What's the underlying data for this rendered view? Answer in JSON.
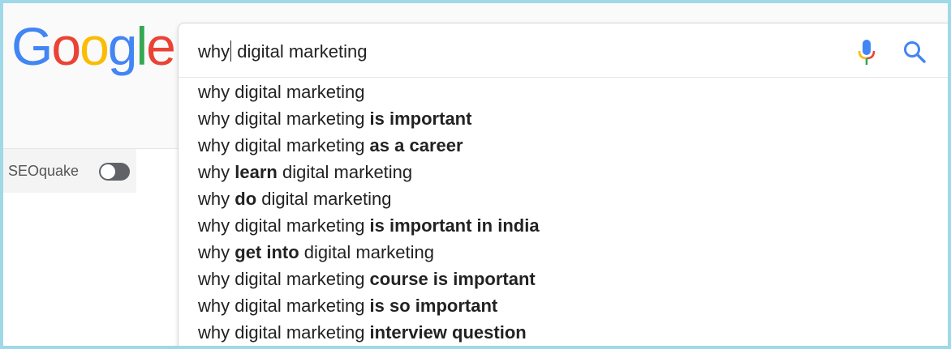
{
  "logo": {
    "text": "Google",
    "letters": [
      {
        "ch": "G",
        "color": "#4285F4"
      },
      {
        "ch": "o",
        "color": "#EA4335"
      },
      {
        "ch": "o",
        "color": "#FBBC05"
      },
      {
        "ch": "g",
        "color": "#4285F4"
      },
      {
        "ch": "l",
        "color": "#34A853"
      },
      {
        "ch": "e",
        "color": "#EA4335"
      }
    ]
  },
  "search": {
    "typed_before_caret": "why",
    "typed_after_caret": " digital marketing",
    "mic_icon": "microphone-icon",
    "search_icon": "magnifier-icon"
  },
  "seoquake": {
    "label": "SEOquake",
    "toggle_state": "off"
  },
  "suggestions": [
    [
      {
        "t": "why digital marketing",
        "b": false
      }
    ],
    [
      {
        "t": "why digital marketing ",
        "b": false
      },
      {
        "t": "is important",
        "b": true
      }
    ],
    [
      {
        "t": "why digital marketing ",
        "b": false
      },
      {
        "t": "as a career",
        "b": true
      }
    ],
    [
      {
        "t": "why ",
        "b": false
      },
      {
        "t": "learn",
        "b": true
      },
      {
        "t": " digital marketing",
        "b": false
      }
    ],
    [
      {
        "t": "why ",
        "b": false
      },
      {
        "t": "do",
        "b": true
      },
      {
        "t": " digital marketing",
        "b": false
      }
    ],
    [
      {
        "t": "why digital marketing ",
        "b": false
      },
      {
        "t": "is important in india",
        "b": true
      }
    ],
    [
      {
        "t": "why ",
        "b": false
      },
      {
        "t": "get into",
        "b": true
      },
      {
        "t": " digital marketing",
        "b": false
      }
    ],
    [
      {
        "t": "why digital marketing ",
        "b": false
      },
      {
        "t": "course is important",
        "b": true
      }
    ],
    [
      {
        "t": "why digital marketing ",
        "b": false
      },
      {
        "t": "is so important",
        "b": true
      }
    ],
    [
      {
        "t": "why digital marketing ",
        "b": false
      },
      {
        "t": "interview question",
        "b": true
      }
    ]
  ],
  "colors": {
    "frame": "#9fd9e8",
    "text": "#222222",
    "google_blue": "#4285F4",
    "google_red": "#EA4335",
    "google_yellow": "#FBBC05",
    "google_green": "#34A853"
  }
}
